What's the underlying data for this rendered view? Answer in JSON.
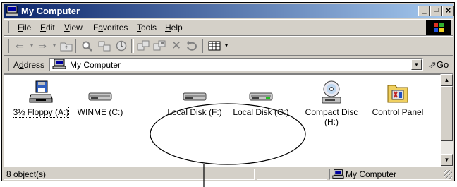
{
  "window": {
    "title": "My Computer",
    "controls": {
      "minimize": "_",
      "maximize": "□",
      "close": "×"
    }
  },
  "menu": [
    {
      "label": "File",
      "key": "F",
      "rest": "ile"
    },
    {
      "label": "Edit",
      "key": "E",
      "rest": "dit"
    },
    {
      "label": "View",
      "key": "V",
      "rest": "iew"
    },
    {
      "label": "Favorites",
      "pre": "F",
      "key": "a",
      "rest": "vorites"
    },
    {
      "label": "Tools",
      "key": "T",
      "rest": "ools"
    },
    {
      "label": "Help",
      "key": "H",
      "rest": "elp"
    }
  ],
  "toolbar": {
    "icons": [
      "back-icon",
      "back-dropdown-icon",
      "forward-icon",
      "forward-dropdown-icon",
      "up-folder-icon",
      "search-icon",
      "folders-icon",
      "history-icon",
      "move-to-icon",
      "copy-to-icon",
      "delete-icon",
      "undo-icon",
      "views-icon"
    ]
  },
  "address": {
    "label": "Address",
    "value": "My Computer",
    "go_label": "Go"
  },
  "drives": [
    {
      "name": "floppy",
      "label": "3½ Floppy (A:)",
      "icon": "floppy-drive-icon",
      "selected": true
    },
    {
      "name": "c",
      "label": "WINME (C:)",
      "icon": "hard-disk-icon",
      "selected": false
    },
    {
      "name": "f",
      "label": "Local Disk (F:)",
      "icon": "hard-disk-icon",
      "selected": false
    },
    {
      "name": "g",
      "label": "Local Disk (G:)",
      "icon": "hard-disk-icon",
      "selected": false
    },
    {
      "name": "h",
      "label": "Compact Disc (H:)",
      "icon": "cd-drive-icon",
      "selected": false
    },
    {
      "name": "cp",
      "label": "Control Panel",
      "icon": "control-panel-icon",
      "selected": false
    }
  ],
  "status": {
    "objects": "8 object(s)",
    "location": "My Computer"
  },
  "colors": {
    "title_start": "#0a246a",
    "title_end": "#a6caf0",
    "face": "#d4d0c8"
  }
}
